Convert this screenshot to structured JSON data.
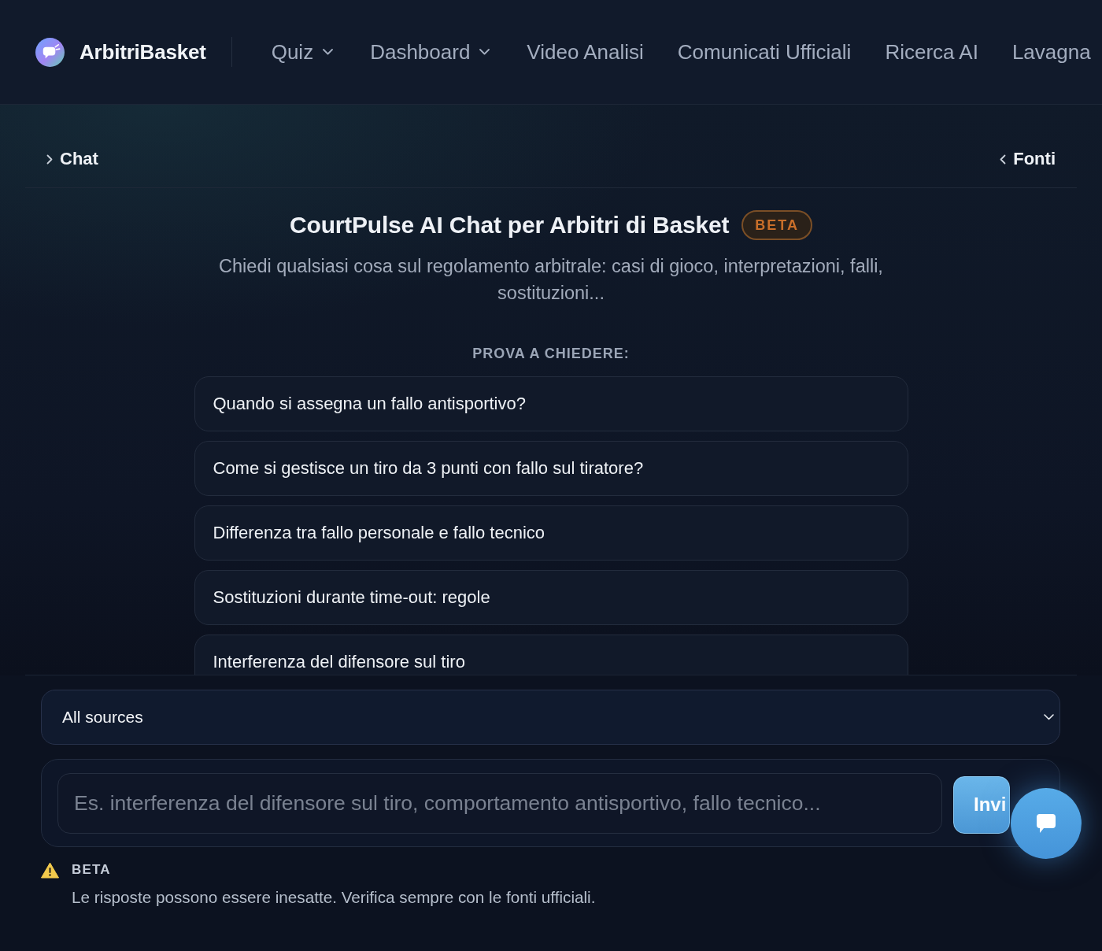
{
  "header": {
    "brand": "ArbitriBasket",
    "nav": [
      {
        "label": "Quiz",
        "dropdown": true
      },
      {
        "label": "Dashboard",
        "dropdown": true
      },
      {
        "label": "Video Analisi",
        "dropdown": false
      },
      {
        "label": "Comunicati Ufficiali",
        "dropdown": false
      },
      {
        "label": "Ricerca AI",
        "dropdown": false
      },
      {
        "label": "Lavagna",
        "dropdown": false
      }
    ]
  },
  "panel_bar": {
    "left_toggle": "Chat",
    "right_toggle": "Fonti"
  },
  "intro": {
    "title": "CourtPulse AI Chat per Arbitri di Basket",
    "badge": "BETA",
    "subtitle": "Chiedi qualsiasi cosa sul regolamento arbitrale: casi di gioco, interpretazioni, falli, sostituzioni...",
    "prompt_heading": "PROVA A CHIEDERE:",
    "suggestions": [
      "Quando si assegna un fallo antisportivo?",
      "Come si gestisce un tiro da 3 punti con fallo sul tiratore?",
      "Differenza tra fallo personale e fallo tecnico",
      "Sostituzioni durante time-out: regole",
      "Interferenza del difensore sul tiro"
    ]
  },
  "source_select": {
    "value": "All sources"
  },
  "composer": {
    "placeholder": "Es. interferenza del difensore sul tiro, comportamento antisportivo, fallo tecnico...",
    "send_button": "Invi"
  },
  "notice": {
    "label": "BETA",
    "text": "Le risposte possono essere inesatte. Verifica sempre con le fonti ufficiali."
  }
}
